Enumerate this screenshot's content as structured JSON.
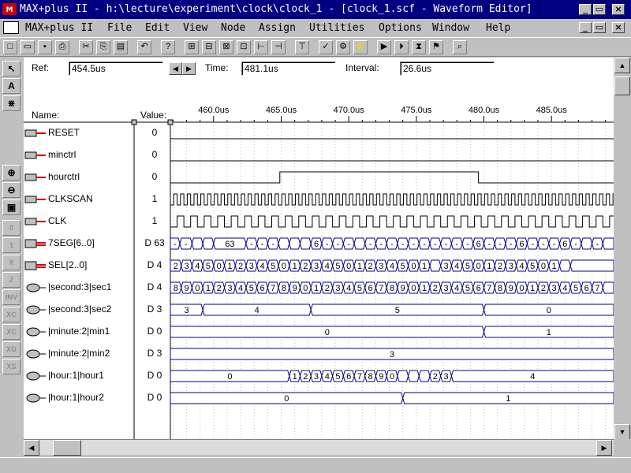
{
  "window": {
    "title": "MAX+plus II - h:\\lecture\\experiment\\clock\\clock_1 - [clock_1.scf - Waveform Editor]"
  },
  "menu": [
    "MAX+plus II",
    "File",
    "Edit",
    "View",
    "Node",
    "Assign",
    "Utilities",
    "Options",
    "Window",
    "Help"
  ],
  "toolbar": {
    "icons": [
      "new-icon",
      "open-icon",
      "save-icon",
      "print-icon",
      "cut-icon",
      "copy-icon",
      "paste-icon",
      "undo-icon",
      "help-pointer-icon",
      "hierarchy-icon",
      "floorplan-icon",
      "compiler-icon",
      "simulator-icon",
      "timing-icon",
      "programmer-icon",
      "open-editor-icon",
      "save-check-icon",
      "save-compile-icon",
      "save-simulate-icon",
      "compile-icon",
      "simulate-icon",
      "timing-analyze-icon",
      "program-icon",
      "find-icon"
    ]
  },
  "left_tools": {
    "top": [
      {
        "name": "select-pointer-icon",
        "glyph": "↖"
      },
      {
        "name": "text-tool-icon",
        "glyph": "A"
      },
      {
        "name": "node-tool-icon",
        "glyph": "⋇"
      }
    ],
    "middle": [
      {
        "name": "zoom-in-icon",
        "glyph": "⊕"
      },
      {
        "name": "zoom-out-icon",
        "glyph": "⊖"
      },
      {
        "name": "fit-window-icon",
        "glyph": "▣"
      }
    ],
    "bottom": [
      {
        "name": "set-0-icon",
        "glyph": "0"
      },
      {
        "name": "set-1-icon",
        "glyph": "1"
      },
      {
        "name": "set-x-icon",
        "glyph": "X"
      },
      {
        "name": "set-z-icon",
        "glyph": "Z"
      },
      {
        "name": "invert-icon",
        "glyph": "INV"
      },
      {
        "name": "clock-value-icon",
        "glyph": "XC"
      },
      {
        "name": "count-value-icon",
        "glyph": "XC"
      },
      {
        "name": "group-value-icon",
        "glyph": "XG"
      },
      {
        "name": "sequence-value-icon",
        "glyph": "XS"
      }
    ]
  },
  "ref": {
    "label": "Ref:",
    "value": "454.5us"
  },
  "time": {
    "label": "Time:",
    "value": "481.1us"
  },
  "interval": {
    "label": "Interval:",
    "value": "26.6us"
  },
  "header": {
    "name_label": "Name:",
    "value_label": "Value:"
  },
  "timescale": {
    "start": 456.8,
    "end": 489.6,
    "ticks": [
      460.0,
      465.0,
      470.0,
      475.0,
      480.0,
      485.0
    ],
    "tick_labels": [
      "460.0us",
      "465.0us",
      "470.0us",
      "475.0us",
      "480.0us",
      "485.0us"
    ]
  },
  "signals": [
    {
      "name": "RESET",
      "value": "0",
      "kind": "input",
      "wave": {
        "type": "bit",
        "segments": [
          [
            456.8,
            489.6,
            0
          ]
        ]
      }
    },
    {
      "name": "minctrl",
      "value": "0",
      "kind": "input",
      "wave": {
        "type": "bit",
        "segments": [
          [
            456.8,
            489.6,
            0
          ]
        ]
      }
    },
    {
      "name": "hourctrl",
      "value": "0",
      "kind": "input",
      "wave": {
        "type": "bit",
        "segments": [
          [
            456.8,
            464.9,
            0
          ],
          [
            464.9,
            479.6,
            1
          ],
          [
            479.6,
            489.6,
            0
          ]
        ]
      }
    },
    {
      "name": "CLKSCAN",
      "value": "1",
      "kind": "input",
      "wave": {
        "type": "clock",
        "period": 0.5
      }
    },
    {
      "name": "CLK",
      "value": "1",
      "kind": "input",
      "wave": {
        "type": "clock",
        "period": 1.0
      }
    },
    {
      "name": "7SEG[6..0]",
      "value": "D 63",
      "kind": "group-output",
      "wave": {
        "type": "bus",
        "segments": [
          [
            456.8,
            457.5,
            "-"
          ],
          [
            457.5,
            458.4,
            "-"
          ],
          [
            458.4,
            459.2,
            ""
          ],
          [
            459.2,
            460.0,
            ""
          ],
          [
            460.0,
            462.4,
            "63"
          ],
          [
            462.4,
            463.2,
            "-"
          ],
          [
            463.2,
            464.0,
            "-"
          ],
          [
            464.0,
            464.8,
            "-"
          ],
          [
            464.8,
            465.6,
            ""
          ],
          [
            465.6,
            466.4,
            ""
          ],
          [
            466.4,
            467.2,
            ""
          ],
          [
            467.2,
            468.0,
            "6"
          ],
          [
            468.0,
            468.8,
            "-"
          ],
          [
            468.8,
            469.6,
            "-"
          ],
          [
            469.6,
            470.4,
            "-"
          ],
          [
            470.4,
            471.2,
            ""
          ],
          [
            471.2,
            472.0,
            "-"
          ],
          [
            472.0,
            472.8,
            "-"
          ],
          [
            472.8,
            473.6,
            "-"
          ],
          [
            473.6,
            474.4,
            "-"
          ],
          [
            474.4,
            475.2,
            "-"
          ],
          [
            475.2,
            476.0,
            "-"
          ],
          [
            476.0,
            476.8,
            "-"
          ],
          [
            476.8,
            477.6,
            "-"
          ],
          [
            477.6,
            478.4,
            "-"
          ],
          [
            478.4,
            479.2,
            "-"
          ],
          [
            479.2,
            480.0,
            "6"
          ],
          [
            480.0,
            480.8,
            "-"
          ],
          [
            480.8,
            481.6,
            "-"
          ],
          [
            481.6,
            482.4,
            "-"
          ],
          [
            482.4,
            483.2,
            "6"
          ],
          [
            483.2,
            484.0,
            "-"
          ],
          [
            484.0,
            484.8,
            "-"
          ],
          [
            484.8,
            485.6,
            "-"
          ],
          [
            485.6,
            486.4,
            "6"
          ],
          [
            486.4,
            487.2,
            "-"
          ],
          [
            487.2,
            488.0,
            ""
          ],
          [
            488.0,
            488.8,
            "-"
          ],
          [
            488.8,
            489.6,
            ""
          ]
        ]
      }
    },
    {
      "name": "SEL[2..0]",
      "value": "D 4",
      "kind": "group-output",
      "wave": {
        "type": "bus",
        "segments": [
          [
            456.8,
            457.6,
            "2"
          ],
          [
            457.6,
            458.4,
            "3"
          ],
          [
            458.4,
            459.2,
            "4"
          ],
          [
            459.2,
            460.0,
            "5"
          ],
          [
            460.0,
            460.8,
            "0"
          ],
          [
            460.8,
            461.6,
            "1"
          ],
          [
            461.6,
            462.4,
            "2"
          ],
          [
            462.4,
            463.2,
            "3"
          ],
          [
            463.2,
            464.0,
            "4"
          ],
          [
            464.0,
            464.8,
            "5"
          ],
          [
            464.8,
            465.6,
            "0"
          ],
          [
            465.6,
            466.4,
            "1"
          ],
          [
            466.4,
            467.2,
            "2"
          ],
          [
            467.2,
            468.0,
            "3"
          ],
          [
            468.0,
            468.8,
            "4"
          ],
          [
            468.8,
            469.6,
            "5"
          ],
          [
            469.6,
            470.4,
            "0"
          ],
          [
            470.4,
            471.2,
            "1"
          ],
          [
            471.2,
            472.0,
            "2"
          ],
          [
            472.0,
            472.8,
            "3"
          ],
          [
            472.8,
            473.6,
            "4"
          ],
          [
            473.6,
            474.4,
            "5"
          ],
          [
            474.4,
            475.2,
            "0"
          ],
          [
            475.2,
            476.0,
            "1"
          ],
          [
            476.0,
            476.8,
            ""
          ],
          [
            476.8,
            477.6,
            "3"
          ],
          [
            477.6,
            478.4,
            "4"
          ],
          [
            478.4,
            479.2,
            "5"
          ],
          [
            479.2,
            480.0,
            "0"
          ],
          [
            480.0,
            480.8,
            "1"
          ],
          [
            480.8,
            481.6,
            "2"
          ],
          [
            481.6,
            482.4,
            "3"
          ],
          [
            482.4,
            483.2,
            "4"
          ],
          [
            483.2,
            484.0,
            "5"
          ],
          [
            484.0,
            484.8,
            "0"
          ],
          [
            484.8,
            485.6,
            "1"
          ],
          [
            485.6,
            486.4,
            ""
          ],
          [
            486.4,
            489.6,
            ""
          ]
        ]
      }
    },
    {
      "name": "|second:3|sec1",
      "value": "D 4",
      "kind": "output",
      "wave": {
        "type": "bus",
        "segments": [
          [
            456.8,
            457.6,
            "8"
          ],
          [
            457.6,
            458.4,
            "9"
          ],
          [
            458.4,
            459.2,
            "0"
          ],
          [
            459.2,
            460.0,
            "1"
          ],
          [
            460.0,
            460.8,
            "2"
          ],
          [
            460.8,
            461.6,
            "3"
          ],
          [
            461.6,
            462.4,
            "4"
          ],
          [
            462.4,
            463.2,
            "5"
          ],
          [
            463.2,
            464.0,
            "6"
          ],
          [
            464.0,
            464.8,
            "7"
          ],
          [
            464.8,
            465.6,
            "8"
          ],
          [
            465.6,
            466.4,
            "9"
          ],
          [
            466.4,
            467.2,
            "0"
          ],
          [
            467.2,
            468.0,
            "1"
          ],
          [
            468.0,
            468.8,
            "2"
          ],
          [
            468.8,
            469.6,
            "3"
          ],
          [
            469.6,
            470.4,
            "4"
          ],
          [
            470.4,
            471.2,
            "5"
          ],
          [
            471.2,
            472.0,
            "6"
          ],
          [
            472.0,
            472.8,
            "7"
          ],
          [
            472.8,
            473.6,
            "8"
          ],
          [
            473.6,
            474.4,
            "9"
          ],
          [
            474.4,
            475.2,
            "0"
          ],
          [
            475.2,
            476.0,
            "1"
          ],
          [
            476.0,
            476.8,
            "2"
          ],
          [
            476.8,
            477.6,
            "3"
          ],
          [
            477.6,
            478.4,
            "4"
          ],
          [
            478.4,
            479.2,
            "5"
          ],
          [
            479.2,
            480.0,
            "6"
          ],
          [
            480.0,
            480.8,
            "7"
          ],
          [
            480.8,
            481.6,
            "8"
          ],
          [
            481.6,
            482.4,
            "9"
          ],
          [
            482.4,
            483.2,
            "0"
          ],
          [
            483.2,
            484.0,
            "1"
          ],
          [
            484.0,
            484.8,
            "2"
          ],
          [
            484.8,
            485.6,
            "3"
          ],
          [
            485.6,
            486.4,
            "4"
          ],
          [
            486.4,
            487.2,
            "5"
          ],
          [
            487.2,
            488.0,
            "6"
          ],
          [
            488.0,
            488.8,
            "7"
          ],
          [
            488.8,
            489.6,
            ""
          ]
        ]
      }
    },
    {
      "name": "|second:3|sec2",
      "value": "D 3",
      "kind": "output",
      "wave": {
        "type": "bus",
        "segments": [
          [
            456.8,
            459.2,
            "3"
          ],
          [
            459.2,
            467.2,
            "4"
          ],
          [
            467.2,
            480.0,
            "5"
          ],
          [
            480.0,
            489.6,
            "0"
          ]
        ]
      }
    },
    {
      "name": "|minute:2|min1",
      "value": "D 0",
      "kind": "output",
      "wave": {
        "type": "bus",
        "segments": [
          [
            456.8,
            480.0,
            "0"
          ],
          [
            480.0,
            489.6,
            "1"
          ]
        ]
      }
    },
    {
      "name": "|minute:2|min2",
      "value": "D 3",
      "kind": "output",
      "wave": {
        "type": "bus",
        "segments": [
          [
            456.8,
            489.6,
            "3"
          ]
        ]
      }
    },
    {
      "name": "|hour:1|hour1",
      "value": "D 0",
      "kind": "output",
      "wave": {
        "type": "bus",
        "segments": [
          [
            456.8,
            465.6,
            "0"
          ],
          [
            465.6,
            466.4,
            "1"
          ],
          [
            466.4,
            467.2,
            "2"
          ],
          [
            467.2,
            468.0,
            "3"
          ],
          [
            468.0,
            468.8,
            "4"
          ],
          [
            468.8,
            469.6,
            "5"
          ],
          [
            469.6,
            470.4,
            "6"
          ],
          [
            470.4,
            471.2,
            "7"
          ],
          [
            471.2,
            472.0,
            "8"
          ],
          [
            472.0,
            472.8,
            "9"
          ],
          [
            472.8,
            473.6,
            "0"
          ],
          [
            473.6,
            474.4,
            ""
          ],
          [
            474.4,
            475.2,
            ""
          ],
          [
            475.2,
            476.0,
            ""
          ],
          [
            476.0,
            476.8,
            "2"
          ],
          [
            476.8,
            477.6,
            "3"
          ],
          [
            477.6,
            489.6,
            "4"
          ]
        ]
      }
    },
    {
      "name": "|hour:1|hour2",
      "value": "D 0",
      "kind": "output",
      "wave": {
        "type": "bus",
        "segments": [
          [
            456.8,
            474.0,
            "0"
          ],
          [
            474.0,
            489.6,
            "1"
          ]
        ]
      }
    }
  ],
  "colors": {
    "titlebar": "#000080",
    "wave": "#000080",
    "grid": "#c0c0c0",
    "icon_red": "#cc0000"
  }
}
